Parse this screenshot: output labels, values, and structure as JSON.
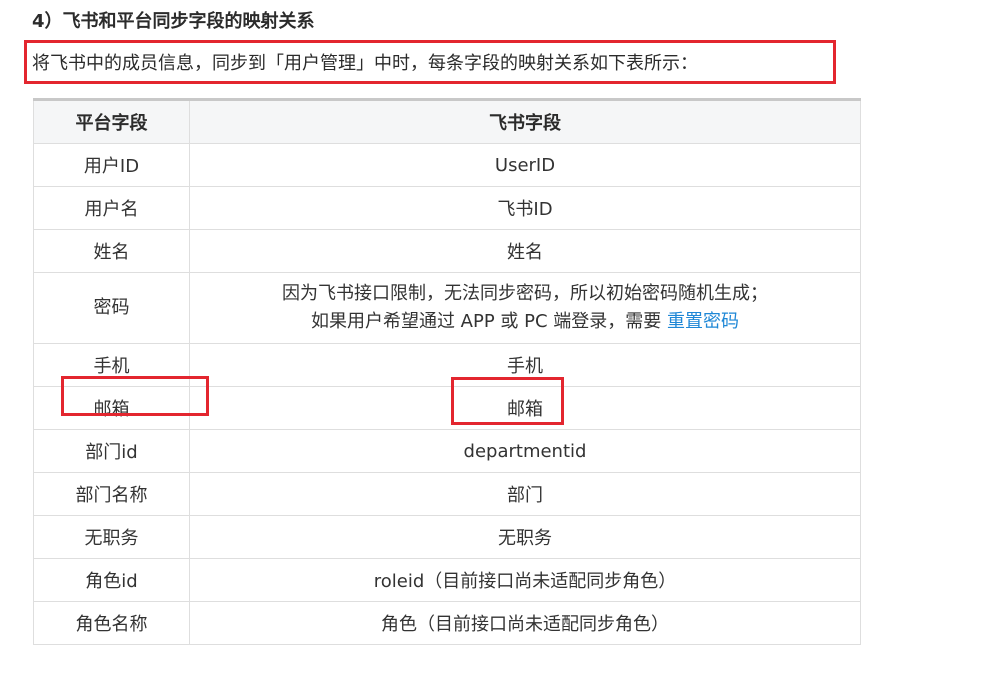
{
  "doc": {
    "heading": "4）飞书和平台同步字段的映射关系",
    "intro": "将飞书中的成员信息，同步到「用户管理」中时，每条字段的映射关系如下表所示："
  },
  "table": {
    "headers": [
      "平台字段",
      "飞书字段"
    ],
    "rows": [
      {
        "platform": "用户ID",
        "feishu": "UserID"
      },
      {
        "platform": "用户名",
        "feishu": "飞书ID"
      },
      {
        "platform": "姓名",
        "feishu": "姓名"
      },
      {
        "platform": "密码",
        "feishu_line1": "因为飞书接口限制，无法同步密码，所以初始密码随机生成；",
        "feishu_line2": "如果用户希望通过 APP 或 PC 端登录，需要",
        "feishu_link": "重置密码"
      },
      {
        "platform": "手机",
        "feishu": "手机"
      },
      {
        "platform": "邮箱",
        "feishu": "邮箱"
      },
      {
        "platform": "部门id",
        "feishu": "departmentid"
      },
      {
        "platform": "部门名称",
        "feishu": "部门"
      },
      {
        "platform": "无职务",
        "feishu": "无职务"
      },
      {
        "platform": "角色id",
        "feishu": "roleid（目前接口尚未适配同步角色）"
      },
      {
        "platform": "角色名称",
        "feishu": "角色（目前接口尚未适配同步角色）"
      }
    ]
  },
  "colors": {
    "highlight_border": "#e3262f",
    "link": "#1e87d6",
    "header_bg": "#f5f6f7",
    "grid": "#dedede"
  }
}
